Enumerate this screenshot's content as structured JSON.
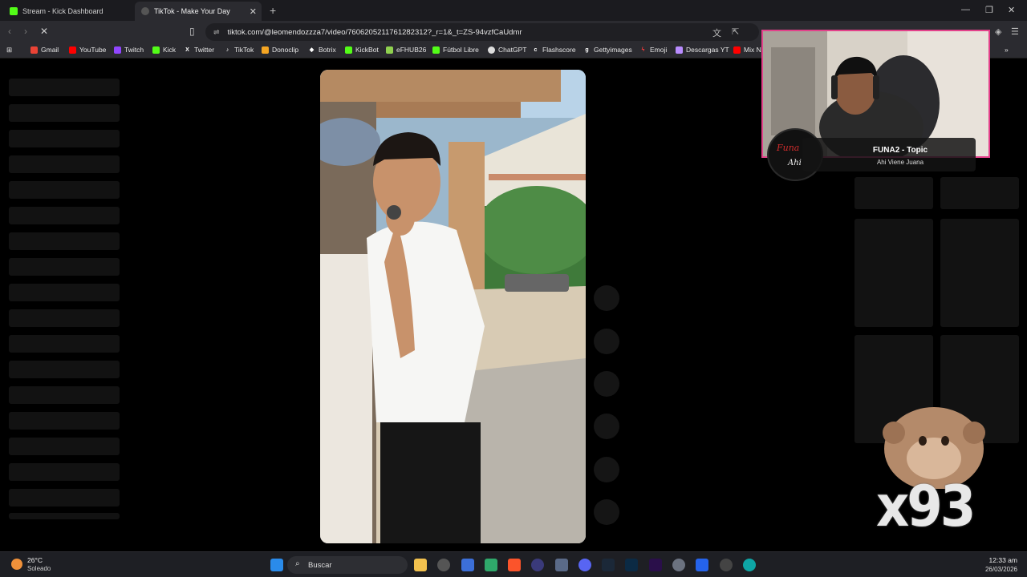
{
  "browser": {
    "tabs": [
      {
        "title": "Stream - Kick Dashboard",
        "favicon_color": "#53fc18"
      },
      {
        "title": "TikTok - Make Your Day",
        "favicon_color": "#cccccc"
      }
    ],
    "new_tab": "+",
    "url": "tiktok.com/@leomendozzza7/video/7606205211761282312?_r=1&_t=ZS-94vzfCaUdmr",
    "bookmarks": [
      {
        "label": "Gmail",
        "icon": "gmail-icon",
        "color": "#ea4335"
      },
      {
        "label": "YouTube",
        "icon": "youtube-icon",
        "color": "#ff0000"
      },
      {
        "label": "Twitch",
        "icon": "twitch-icon",
        "color": "#9146ff"
      },
      {
        "label": "Kick",
        "icon": "kick-icon",
        "color": "#53fc18"
      },
      {
        "label": "Twitter",
        "icon": "x-icon",
        "color": "#ffffff"
      },
      {
        "label": "TikTok",
        "icon": "tiktok-icon",
        "color": "#ffffff"
      },
      {
        "label": "Donoclip",
        "icon": "donoclip-icon",
        "color": "#f5a623"
      },
      {
        "label": "Botrix",
        "icon": "botrix-icon",
        "color": "#ffffff"
      },
      {
        "label": "KickBot",
        "icon": "kickbot-icon",
        "color": "#53fc18"
      },
      {
        "label": "eFHUB26",
        "icon": "efhub-icon",
        "color": "#8fd14f"
      },
      {
        "label": "Fútbol Libre",
        "icon": "futbol-icon",
        "color": "#53fc18"
      },
      {
        "label": "ChatGPT",
        "icon": "chatgpt-icon",
        "color": "#ffffff"
      },
      {
        "label": "Flashscore",
        "icon": "flashscore-icon",
        "color": "#ffffff"
      },
      {
        "label": "Gettyimages",
        "icon": "getty-icon",
        "color": "#ffffff"
      },
      {
        "label": "Emoji",
        "icon": "emoji-icon",
        "color": "#ff3b3b"
      },
      {
        "label": "Descargas YT",
        "icon": "descargas-icon",
        "color": "#b98cff"
      },
      {
        "label": "Mix N",
        "icon": "mix-icon",
        "color": "#ff0000"
      }
    ]
  },
  "overlay": {
    "song_title": "FUNA2 - Topic",
    "song_subtitle": "Ahi Viene Juana",
    "counter": "x93"
  },
  "taskbar": {
    "weather_temp": "26°C",
    "weather_desc": "Soleado",
    "search_placeholder": "Buscar",
    "time": "12:33 am",
    "date": "26/03/2026"
  }
}
